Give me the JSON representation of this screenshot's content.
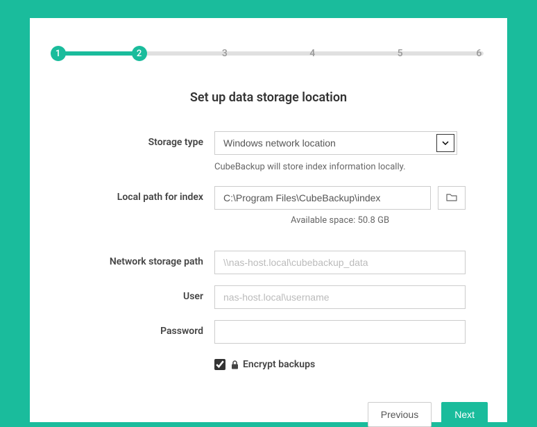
{
  "stepper": {
    "steps": [
      "1",
      "2",
      "3",
      "4",
      "5",
      "6"
    ],
    "current": 2
  },
  "title": "Set up data storage location",
  "labels": {
    "storage_type": "Storage type",
    "local_path": "Local path for index",
    "network_path": "Network storage path",
    "user": "User",
    "password": "Password"
  },
  "fields": {
    "storage_type_value": "Windows network location",
    "hint": "CubeBackup will store index information locally.",
    "local_path_value": "C:\\Program Files\\CubeBackup\\index",
    "available_space": "Available space: 50.8 GB",
    "network_path_placeholder": "\\\\nas-host.local\\cubebackup_data",
    "user_placeholder": "nas-host.local\\username",
    "password_value": ""
  },
  "encrypt": {
    "checked": true,
    "label": "Encrypt backups"
  },
  "buttons": {
    "previous": "Previous",
    "next": "Next"
  }
}
